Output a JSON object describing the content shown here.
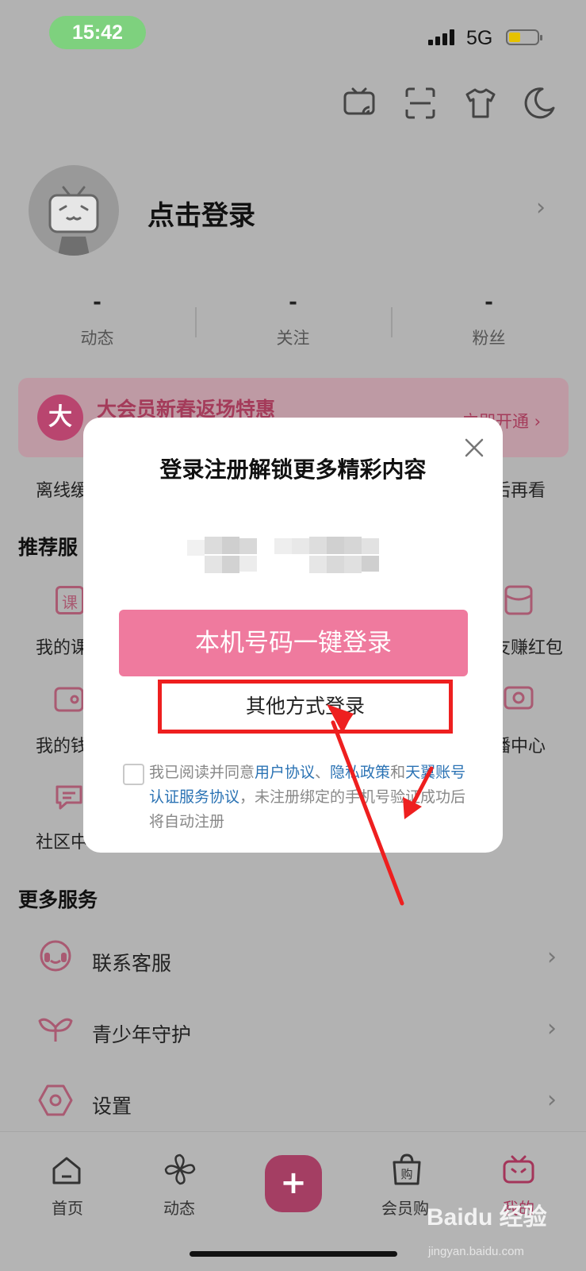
{
  "status_bar": {
    "time": "15:42",
    "network": "5G"
  },
  "profile": {
    "login_prompt": "点击登录"
  },
  "stats": [
    {
      "value": "-",
      "label": "动态"
    },
    {
      "value": "-",
      "label": "关注"
    },
    {
      "value": "-",
      "label": "粉丝"
    }
  ],
  "vip_banner": {
    "badge": "大",
    "title": "大会员新春返场特惠",
    "cta": "立即开通 ›"
  },
  "quick_row": {
    "left": "离线缓",
    "right": "后再看"
  },
  "recommended": {
    "title": "推荐服",
    "left_items": [
      "我的课",
      "我的钱",
      "社区中"
    ],
    "right_items": [
      "友赚红包",
      "播中心"
    ],
    "course_icon_char": "课"
  },
  "more_services": {
    "title": "更多服务",
    "items": [
      "联系客服",
      "青少年守护",
      "设置"
    ]
  },
  "bottom_nav": {
    "items": [
      "首页",
      "动态",
      "会员购",
      "我的"
    ],
    "plus": "+",
    "shop_char": "购"
  },
  "modal": {
    "title": "登录注册解锁更多精彩内容",
    "primary_button": "本机号码一键登录",
    "secondary_button": "其他方式登录",
    "agreement": {
      "t1": "我已阅读并同意",
      "l1": "用户协议",
      "t2": "、",
      "l2": "隐私政策",
      "t3": "和",
      "l3": "天翼账号认证服务协议",
      "t4": "，未注册绑定的手机号验证成功后将自动注册"
    }
  },
  "watermark": {
    "brand": "Baidu 经验",
    "url": "jingyan.baidu.com"
  },
  "colors": {
    "accent_pink": "#ef7a9e",
    "highlight_red": "#ee1f1f",
    "link_blue": "#2b73b4",
    "status_green": "#7ed17e"
  }
}
